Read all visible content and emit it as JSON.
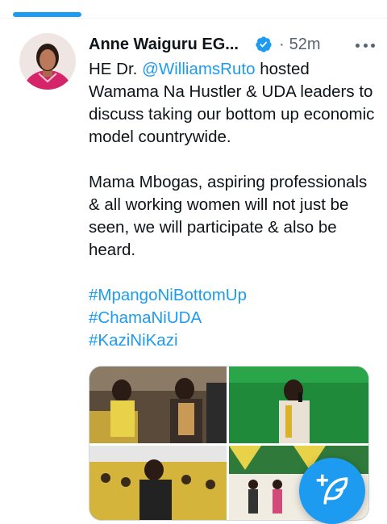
{
  "colors": {
    "accent": "#1d9bf0",
    "text": "#0f1419",
    "muted": "#536471",
    "border": "#cfd9de"
  },
  "tweet": {
    "author_name": "Anne Waiguru EG...",
    "verified_icon": "verified-badge-icon",
    "separator": "·",
    "timestamp": "52m",
    "more_icon": "more-horizontal-icon",
    "body": {
      "line1_prefix": "HE Dr. ",
      "mention": "@WilliamsRuto",
      "line1_suffix": " hosted Wamama Na Hustler & UDA leaders to discuss taking our bottom up economic model countrywide.",
      "para2": "Mama Mbogas, aspiring professionals & all working women will not just be seen, we will participate & also be heard.",
      "hashtags": [
        "#MpangoNiBottomUp",
        "#ChamaNiUDA",
        "#KaziNiKazi"
      ]
    },
    "media_photos": [
      "photo-1",
      "photo-2",
      "photo-3",
      "photo-4"
    ]
  },
  "compose_icon": "compose-tweet-icon"
}
